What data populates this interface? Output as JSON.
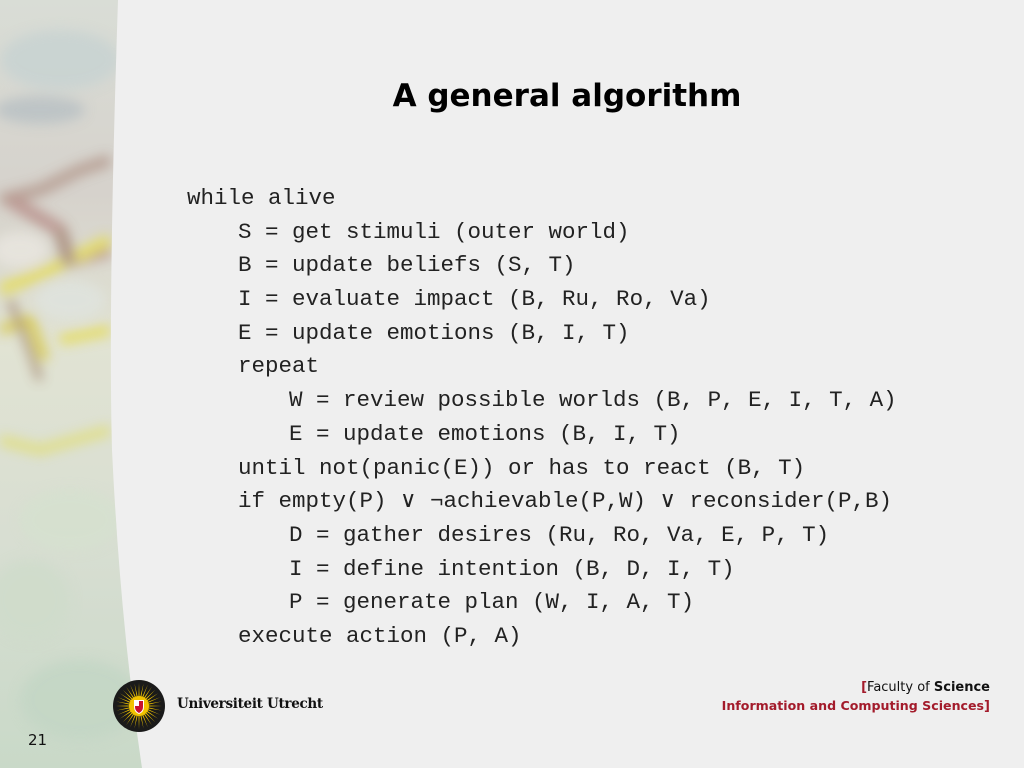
{
  "slide": {
    "title": "A general algorithm",
    "page_number": "21"
  },
  "code": {
    "lines": [
      {
        "indent": 0,
        "text": "while alive"
      },
      {
        "indent": 1,
        "text": "S = get stimuli (outer world)"
      },
      {
        "indent": 1,
        "text": "B = update beliefs (S, T)"
      },
      {
        "indent": 1,
        "text": "I = evaluate impact (B, Ru, Ro, Va)"
      },
      {
        "indent": 1,
        "text": "E = update emotions (B, I, T)"
      },
      {
        "indent": 1,
        "text": "repeat"
      },
      {
        "indent": 2,
        "text": "W = review possible worlds (B, P, E, I, T, A)"
      },
      {
        "indent": 2,
        "text": "E = update emotions (B, I, T)"
      },
      {
        "indent": 1,
        "text": "until not(panic(E)) or has to react (B, T)"
      },
      {
        "indent": 1,
        "text": "if empty(P) ∨ ¬achievable(P,W) ∨ reconsider(P,B)"
      },
      {
        "indent": 2,
        "text": "D = gather desires (Ru, Ro, Va, E, P, T)"
      },
      {
        "indent": 2,
        "text": "I = define intention (B, D, I, T)"
      },
      {
        "indent": 2,
        "text": "P = generate plan (W, I, A, T)"
      },
      {
        "indent": 1,
        "text": "execute action (P, A)"
      }
    ]
  },
  "footer": {
    "university": "Universiteit Utrecht",
    "faculty_open_bracket": "[",
    "faculty_prefix": "Faculty of ",
    "faculty_name": "Science",
    "department": "Information and Computing Sciences",
    "department_close_bracket": "]",
    "logo_icon": "university-sun-seal-icon"
  },
  "colors": {
    "background": "#efefef",
    "accent_red": "#a31b2b",
    "logo_yellow": "#f0c400",
    "text": "#222222"
  }
}
